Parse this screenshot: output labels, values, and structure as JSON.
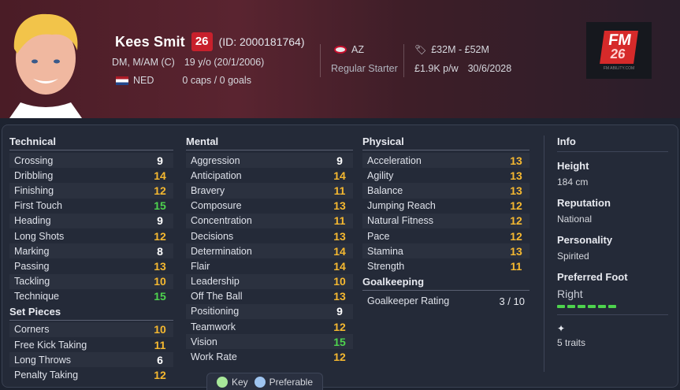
{
  "header": {
    "name": "Kees Smit",
    "number": "26",
    "id_text": "(ID: 2000181764)",
    "positions": "DM, M/AM (C)",
    "age": "19 y/o (20/1/2006)",
    "nationality": "NED",
    "caps": "0 caps / 0 goals",
    "club": "AZ",
    "role": "Regular Starter",
    "value": "£32M - £52M",
    "wage": "£1.9K p/w",
    "contract": "30/6/2028",
    "logo_text": "FM",
    "logo_sub": "26"
  },
  "technical": {
    "title": "Technical",
    "rows": [
      {
        "name": "Crossing",
        "value": "9",
        "tier": "white"
      },
      {
        "name": "Dribbling",
        "value": "14",
        "tier": "orange"
      },
      {
        "name": "Finishing",
        "value": "12",
        "tier": "orange"
      },
      {
        "name": "First Touch",
        "value": "15",
        "tier": "green"
      },
      {
        "name": "Heading",
        "value": "9",
        "tier": "white"
      },
      {
        "name": "Long Shots",
        "value": "12",
        "tier": "orange"
      },
      {
        "name": "Marking",
        "value": "8",
        "tier": "white"
      },
      {
        "name": "Passing",
        "value": "13",
        "tier": "orange"
      },
      {
        "name": "Tackling",
        "value": "10",
        "tier": "orange"
      },
      {
        "name": "Technique",
        "value": "15",
        "tier": "green"
      }
    ]
  },
  "set_pieces": {
    "title": "Set Pieces",
    "rows": [
      {
        "name": "Corners",
        "value": "10",
        "tier": "orange"
      },
      {
        "name": "Free Kick Taking",
        "value": "11",
        "tier": "orange"
      },
      {
        "name": "Long Throws",
        "value": "6",
        "tier": "white"
      },
      {
        "name": "Penalty Taking",
        "value": "12",
        "tier": "orange"
      }
    ]
  },
  "mental": {
    "title": "Mental",
    "rows": [
      {
        "name": "Aggression",
        "value": "9",
        "tier": "white"
      },
      {
        "name": "Anticipation",
        "value": "14",
        "tier": "orange"
      },
      {
        "name": "Bravery",
        "value": "11",
        "tier": "orange"
      },
      {
        "name": "Composure",
        "value": "13",
        "tier": "orange"
      },
      {
        "name": "Concentration",
        "value": "11",
        "tier": "orange"
      },
      {
        "name": "Decisions",
        "value": "13",
        "tier": "orange"
      },
      {
        "name": "Determination",
        "value": "14",
        "tier": "orange"
      },
      {
        "name": "Flair",
        "value": "14",
        "tier": "orange"
      },
      {
        "name": "Leadership",
        "value": "10",
        "tier": "orange"
      },
      {
        "name": "Off The Ball",
        "value": "13",
        "tier": "orange"
      },
      {
        "name": "Positioning",
        "value": "9",
        "tier": "white"
      },
      {
        "name": "Teamwork",
        "value": "12",
        "tier": "orange"
      },
      {
        "name": "Vision",
        "value": "15",
        "tier": "green"
      },
      {
        "name": "Work Rate",
        "value": "12",
        "tier": "orange"
      }
    ]
  },
  "physical": {
    "title": "Physical",
    "rows": [
      {
        "name": "Acceleration",
        "value": "13",
        "tier": "orange"
      },
      {
        "name": "Agility",
        "value": "13",
        "tier": "orange"
      },
      {
        "name": "Balance",
        "value": "13",
        "tier": "orange"
      },
      {
        "name": "Jumping Reach",
        "value": "12",
        "tier": "orange"
      },
      {
        "name": "Natural Fitness",
        "value": "12",
        "tier": "orange"
      },
      {
        "name": "Pace",
        "value": "12",
        "tier": "orange"
      },
      {
        "name": "Stamina",
        "value": "13",
        "tier": "orange"
      },
      {
        "name": "Strength",
        "value": "11",
        "tier": "orange"
      }
    ]
  },
  "goalkeeping": {
    "title": "Goalkeeping",
    "rating_label": "Goalkeeper Rating",
    "rating_value": "3 / 10"
  },
  "info": {
    "title": "Info",
    "height_label": "Height",
    "height_value": "184 cm",
    "reputation_label": "Reputation",
    "reputation_value": "National",
    "personality_label": "Personality",
    "personality_value": "Spirited",
    "foot_label": "Preferred Foot",
    "foot_value": "Right",
    "foot_strength_bars": 6,
    "traits_value": "5 traits"
  },
  "legend": {
    "key_label": "Key",
    "preferable_label": "Preferable"
  }
}
